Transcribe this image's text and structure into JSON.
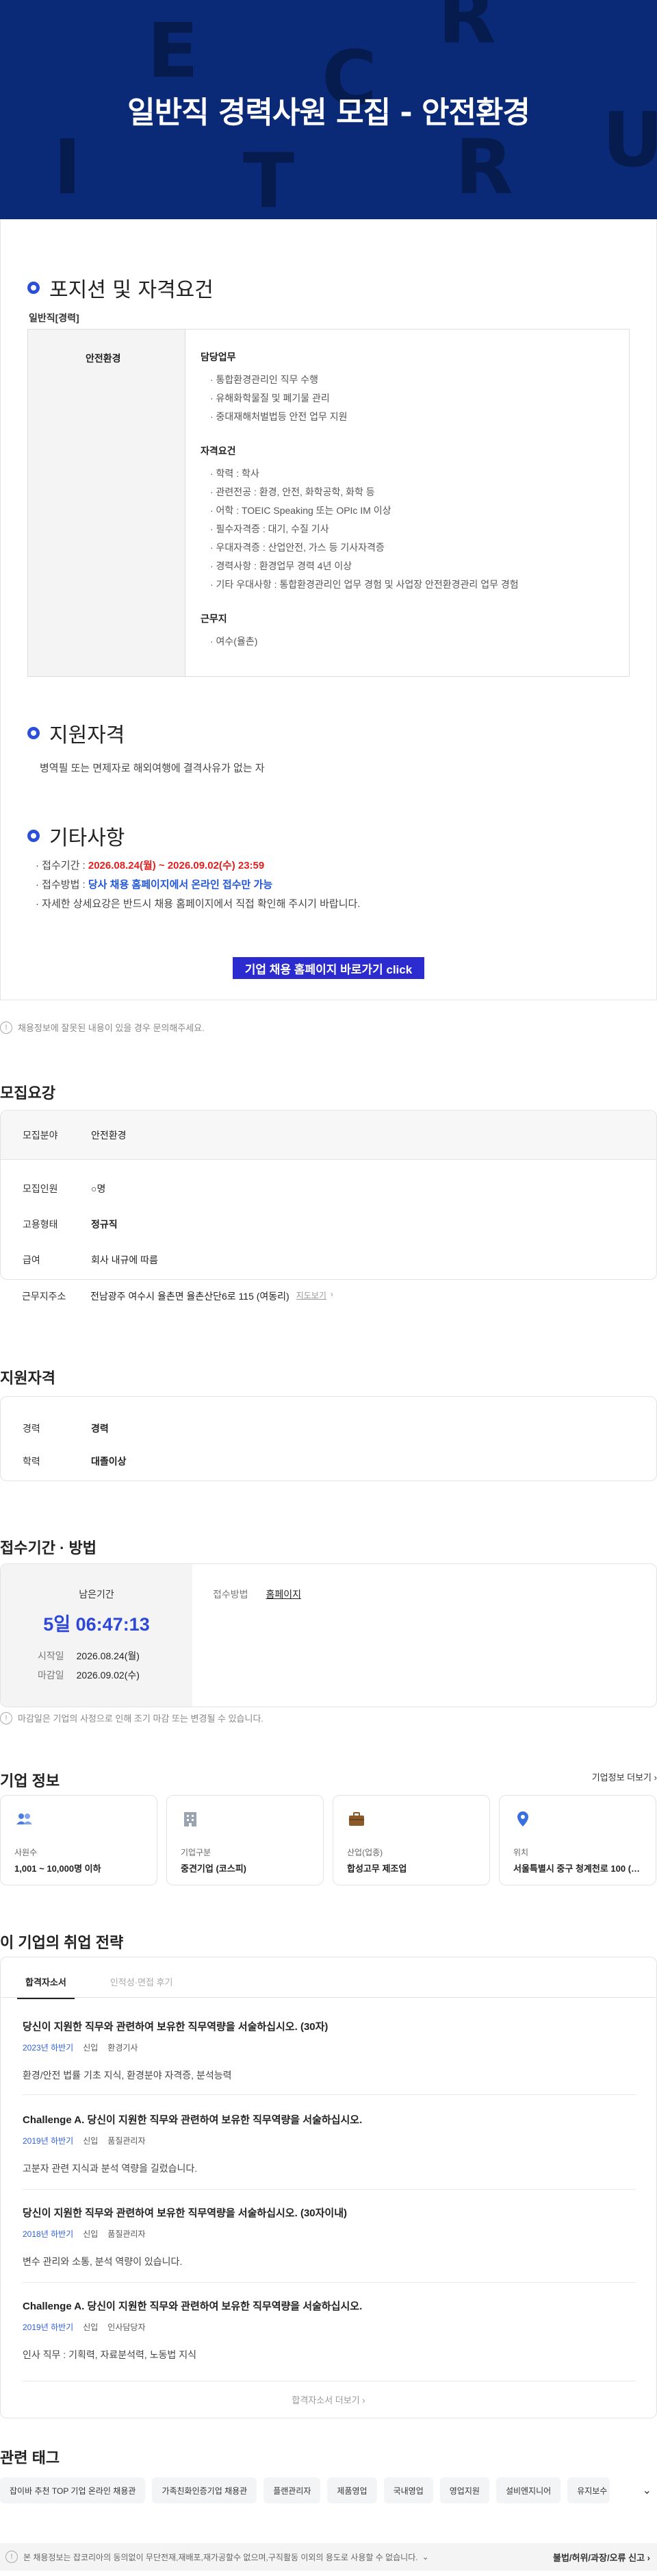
{
  "hero": {
    "title": "일반직 경력사원 모집 - 안전환경",
    "bg_letters": [
      "E",
      "R",
      "C",
      "R",
      "I",
      "U",
      "T",
      "R"
    ]
  },
  "posting": {
    "section1_title": "포지션 및 자격요건",
    "category_label": "일반직[경력]",
    "position_name": "안전환경",
    "duties_title": "담당업무",
    "duties": [
      "· 통합환경관리인 직무 수행",
      "· 유해화학물질 및 폐기물 관리",
      "· 중대재해처벌법등 안전 업무 지원"
    ],
    "qual_title": "자격요건",
    "quals": [
      "· 학력 : 학사",
      "· 관련전공 : 환경, 안전, 화학공학, 화학 등",
      "· 어학 : TOEIC Speaking 또는 OPIc IM 이상",
      "· 필수자격증 : 대기, 수질 기사",
      "· 우대자격증 : 산업안전, 가스 등 기사자격증",
      "· 경력사항 : 환경업무 경력 4년 이상",
      "· 기타 우대사항 : 통합환경관리인 업무 경험 및 사업장 안전환경관리 업무 경험"
    ],
    "location_title": "근무지",
    "locations": [
      "· 여수(율촌)"
    ],
    "section2_title": "지원자격",
    "eligibility_text": "병역필 또는 면제자로 해외여행에 결격사유가 없는 자",
    "section3_title": "기타사항",
    "period_label": "· 접수기간 : ",
    "period_value": "2026.08.24(월) ~ 2026.09.02(수) 23:59",
    "method_label": "· 접수방법 : ",
    "method_value": "당사 채용 홈페이지에서 온라인 접수만 가능",
    "detail_text": "· 자세한 상세요강은 반드시 채용 홈페이지에서 직접 확인해 주시기 바랍니다.",
    "cta_label": "기업 채용 홈페이지 바로가기 click"
  },
  "notice1": "채용정보에 잘못된 내용이 있을 경우 문의해주세요.",
  "summary": {
    "title": "모집요강",
    "field_label": "모집분야",
    "field_value": "안전환경",
    "count_label": "모집인원",
    "count_value": "○명",
    "type_label": "고용형태",
    "type_value": "정규직",
    "salary_label": "급여",
    "salary_value": "회사 내규에 따름",
    "address_label": "근무지주소",
    "address_value": "전남광주 여수시 율촌면 율촌산단6로 115 (여동리)",
    "map_link": "지도보기"
  },
  "qualify": {
    "title": "지원자격",
    "career_label": "경력",
    "career_value": "경력",
    "edu_label": "학력",
    "edu_value": "대졸이상"
  },
  "apply": {
    "title": "접수기간 · 방법",
    "remain_label": "남은기간",
    "remain_time": "5일 06:47:13",
    "start_label": "시작일",
    "start_value": "2026.08.24(월)",
    "end_label": "마감일",
    "end_value": "2026.09.02(수)",
    "method_label": "접수방법",
    "method_value": "홈페이지"
  },
  "notice2": "마감일은 기업의 사정으로 인해 조기 마감 또는 변경될 수 있습니다.",
  "company": {
    "title": "기업 정보",
    "more_link": "기업정보 더보기",
    "cards": [
      {
        "icon": "people-icon",
        "label": "사원수",
        "value": "1,001 ~ 10,000명 이하",
        "color": "#4a7be0"
      },
      {
        "icon": "building-icon",
        "label": "기업구분",
        "value": "중견기업 (코스피)",
        "color": "#9aa3b0"
      },
      {
        "icon": "briefcase-icon",
        "label": "산업(업종)",
        "value": "합성고무 제조업",
        "color": "#8a5a2b"
      },
      {
        "icon": "location-pin-icon",
        "label": "위치",
        "value": "서울특별시 중구 청계천로 100 (…",
        "color": "#3a6fe0"
      }
    ]
  },
  "strategy": {
    "title": "이 기업의 취업 전략",
    "tabs": [
      "합격자소서",
      "인적성·면접 후기"
    ],
    "items": [
      {
        "q": "당신이 지원한 직무와 관련하여 보유한 직무역량을 서술하십시오. (30자)",
        "year": "2023년 하반기",
        "level": "신입",
        "job": "환경기사",
        "a": "환경/안전 법률 기초 지식, 환경분야 자격증, 분석능력"
      },
      {
        "q": "Challenge A. 당신이 지원한 직무와 관련하여 보유한 직무역량을 서술하십시오.",
        "year": "2019년 하반기",
        "level": "신입",
        "job": "품질관리자",
        "a": "고분자 관련 지식과 분석 역량을 길렀습니다."
      },
      {
        "q": "당신이 지원한 직무와 관련하여 보유한 직무역량을 서술하십시오. (30자이내)",
        "year": "2018년 하반기",
        "level": "신입",
        "job": "품질관리자",
        "a": "변수 관리와 소통, 분석 역량이 있습니다."
      },
      {
        "q": "Challenge A. 당신이 지원한 직무와 관련하여 보유한 직무역량을 서술하십시오.",
        "year": "2019년 하반기",
        "level": "신입",
        "job": "인사담당자",
        "a": "인사 직무 : 기획력, 자료분석력, 노동법 지식"
      }
    ],
    "more": "합격자소서 더보기"
  },
  "tags": {
    "title": "관련 태그",
    "items": [
      "잡이바 추천 TOP 기업 온라인 채용관",
      "가족친화인증기업 채용관",
      "플랜관리자",
      "제품영업",
      "국내영업",
      "영업지원",
      "설비엔지니어",
      "유지보수"
    ]
  },
  "footer": {
    "text": "본 채용정보는 잡코리아의 동의없이 무단전재,재배포,재가공할수 없으며,구직활동 이외의 용도로 사용할 수 없습니다.",
    "report": "불법/허위/과장/오류 신고"
  }
}
